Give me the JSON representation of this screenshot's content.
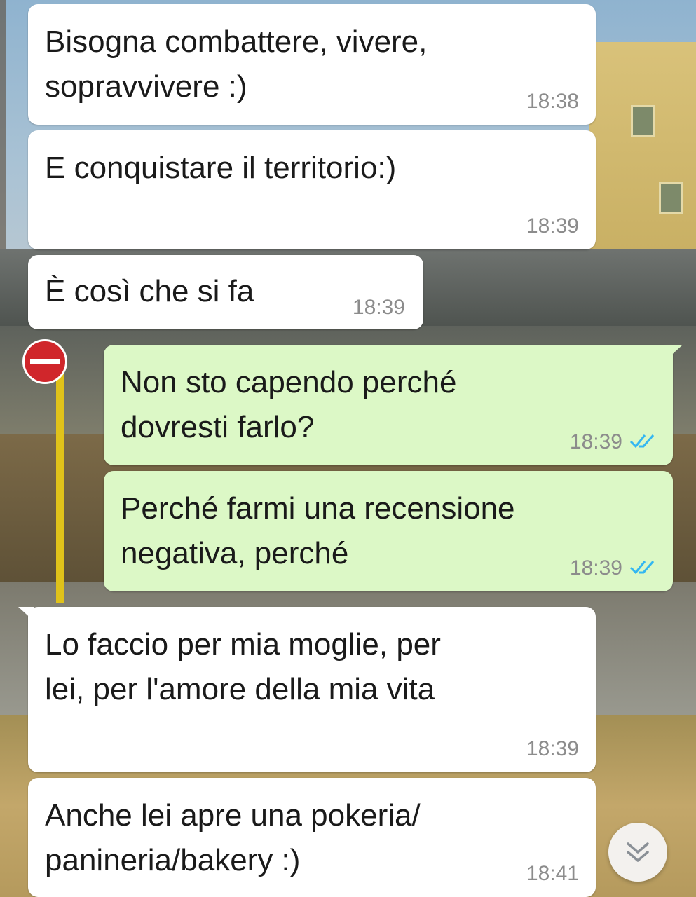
{
  "messages": [
    {
      "direction": "incoming",
      "text": "Bisogna combattere, vivere,\nsopravvivere :)",
      "time": "18:38"
    },
    {
      "direction": "incoming",
      "text": "E conquistare il territorio:)",
      "time": "18:39"
    },
    {
      "direction": "incoming",
      "text": "È così che si fa",
      "time": "18:39"
    },
    {
      "direction": "outgoing",
      "text": "Non sto capendo perché\ndovresti farlo?",
      "time": "18:39",
      "status": "read"
    },
    {
      "direction": "outgoing",
      "text": "Perché farmi una recensione\nnegativa, perché",
      "time": "18:39",
      "status": "read"
    },
    {
      "direction": "incoming",
      "text": "Lo faccio per mia moglie, per\nlei, per l'amore della mia vita",
      "time": "18:39"
    },
    {
      "direction": "incoming",
      "text": "Anche lei apre una pokeria/\npanineria/bakery :)",
      "time": "18:41"
    }
  ],
  "icons": {
    "read_receipt": "double-check-icon",
    "scroll_down": "chevron-down-double-icon"
  },
  "colors": {
    "incoming_bubble": "#ffffff",
    "outgoing_bubble": "#dcf8c6",
    "timestamp": "#8c8c8c",
    "read_check": "#34b7f1"
  }
}
